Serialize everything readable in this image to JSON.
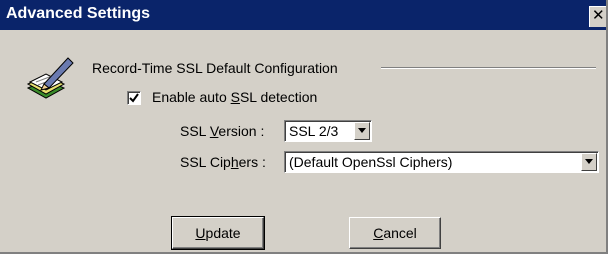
{
  "window": {
    "title": "Advanced Settings",
    "close_glyph": "✕",
    "close_icon": "close-icon"
  },
  "group": {
    "title": "Record-Time SSL Default Configuration",
    "icon": "record-settings-icon"
  },
  "auto_ssl": {
    "label_before": "Enable auto ",
    "label_mnemonic": "S",
    "label_after": "SL detection",
    "checked": true
  },
  "ssl_version": {
    "label_before": "SSL ",
    "label_mnemonic": "V",
    "label_after": "ersion :",
    "value": "SSL 2/3"
  },
  "ssl_ciphers": {
    "label_before": "SSL Cip",
    "label_mnemonic": "h",
    "label_after": "ers :",
    "value": "(Default OpenSsl Ciphers)"
  },
  "buttons": {
    "update": {
      "mnemonic": "U",
      "rest": "pdate"
    },
    "cancel": {
      "mnemonic": "C",
      "rest": "ancel"
    }
  },
  "colors": {
    "title_bar": "#0a246a",
    "face": "#d4d0c8"
  }
}
